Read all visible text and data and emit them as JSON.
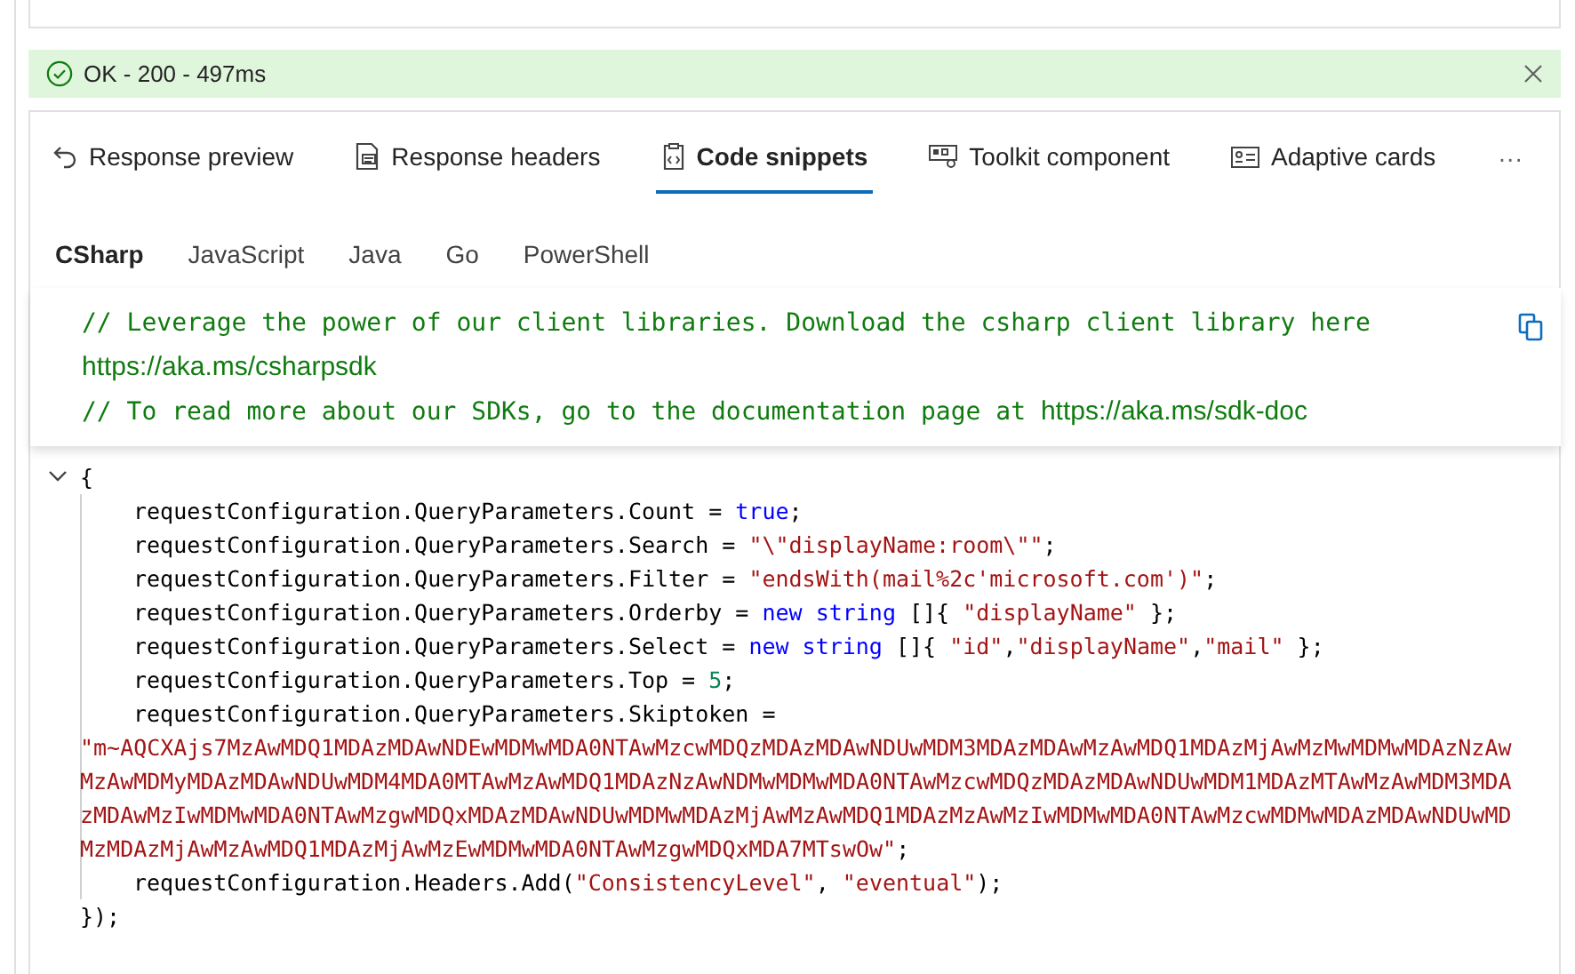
{
  "status": {
    "text": "OK - 200 - 497ms",
    "kind": "success"
  },
  "tabs": [
    {
      "label": "Response preview",
      "selected": false
    },
    {
      "label": "Response headers",
      "selected": false
    },
    {
      "label": "Code snippets",
      "selected": true
    },
    {
      "label": "Toolkit component",
      "selected": false
    },
    {
      "label": "Adaptive cards",
      "selected": false
    }
  ],
  "more_button": "···",
  "languages": [
    {
      "label": "CSharp",
      "selected": true
    },
    {
      "label": "JavaScript",
      "selected": false
    },
    {
      "label": "Java",
      "selected": false
    },
    {
      "label": "Go",
      "selected": false
    },
    {
      "label": "PowerShell",
      "selected": false
    }
  ],
  "notice": [
    [
      {
        "text": "// Leverage the power of our client libraries. Download the csharp client library here",
        "kind": "comment"
      }
    ],
    [
      {
        "text": "https://aka.ms/csharpsdk",
        "kind": "link"
      }
    ],
    [
      {
        "text": "// To read more about our SDKs, go to the documentation page at ",
        "kind": "comment"
      },
      {
        "text": "https://aka.ms/sdk-doc",
        "kind": "link"
      }
    ]
  ],
  "code": [
    {
      "indented": false,
      "fold": {
        "expanded": true
      },
      "tokens": [
        {
          "text": "{",
          "kind": "plain"
        }
      ]
    },
    {
      "indented": true,
      "tokens": [
        {
          "text": "requestConfiguration.QueryParameters.Count = ",
          "kind": "plain"
        },
        {
          "text": "true",
          "kind": "keyword"
        },
        {
          "text": ";",
          "kind": "plain"
        }
      ]
    },
    {
      "indented": true,
      "tokens": [
        {
          "text": "requestConfiguration.QueryParameters.Search = ",
          "kind": "plain"
        },
        {
          "text": "\"\\\"displayName:room\\\"\"",
          "kind": "string"
        },
        {
          "text": ";",
          "kind": "plain"
        }
      ]
    },
    {
      "indented": true,
      "tokens": [
        {
          "text": "requestConfiguration.QueryParameters.Filter = ",
          "kind": "plain"
        },
        {
          "text": "\"endsWith(mail%2c'microsoft.com')\"",
          "kind": "string"
        },
        {
          "text": ";",
          "kind": "plain"
        }
      ]
    },
    {
      "indented": true,
      "tokens": [
        {
          "text": "requestConfiguration.QueryParameters.Orderby = ",
          "kind": "plain"
        },
        {
          "text": "new string",
          "kind": "keyword"
        },
        {
          "text": " []{ ",
          "kind": "plain"
        },
        {
          "text": "\"displayName\"",
          "kind": "string"
        },
        {
          "text": " };",
          "kind": "plain"
        }
      ]
    },
    {
      "indented": true,
      "tokens": [
        {
          "text": "requestConfiguration.QueryParameters.Select = ",
          "kind": "plain"
        },
        {
          "text": "new string",
          "kind": "keyword"
        },
        {
          "text": " []{ ",
          "kind": "plain"
        },
        {
          "text": "\"id\"",
          "kind": "string"
        },
        {
          "text": ",",
          "kind": "plain"
        },
        {
          "text": "\"displayName\"",
          "kind": "string"
        },
        {
          "text": ",",
          "kind": "plain"
        },
        {
          "text": "\"mail\"",
          "kind": "string"
        },
        {
          "text": " };",
          "kind": "plain"
        }
      ]
    },
    {
      "indented": true,
      "tokens": [
        {
          "text": "requestConfiguration.QueryParameters.Top = ",
          "kind": "plain"
        },
        {
          "text": "5",
          "kind": "number"
        },
        {
          "text": ";",
          "kind": "plain"
        }
      ]
    },
    {
      "indented": true,
      "tokens": [
        {
          "text": "requestConfiguration.QueryParameters.Skiptoken =",
          "kind": "plain"
        }
      ]
    },
    {
      "indented": false,
      "tokens": [
        {
          "text": "\"m~AQCXAjs7MzAwMDQ1MDAzMDAwNDEwMDMwMDA0NTAwMzcwMDQzMDAzMDAwNDUwMDM3MDAzMDAwMzAwMDQ1MDAzMjAwMzMwMDMwMDAzNzAwMzAwMDMyMDAzMDAwNDUwMDM4MDA0MTAwMzAwMDQ1MDAzNzAwNDMwMDMwMDA0NTAwMzcwMDQzMDAzMDAwNDUwMDM1MDAzMTAwMzAwMDM3MDAzMDAwMzIwMDMwMDA0NTAwMzgwMDQxMDAzMDAwNDUwMDMwMDAzMjAwMzAwMDQ1MDAzMzAwMzIwMDMwMDA0NTAwMzcwMDMwMDAzMDAwNDUwMDMzMDAzMjAwMzAwMDQ1MDAzMjAwMzEwMDMwMDA0NTAwMzgwMDQxMDA7MTswOw\"",
          "kind": "string"
        },
        {
          "text": ";",
          "kind": "plain"
        }
      ]
    },
    {
      "indented": true,
      "tokens": [
        {
          "text": "requestConfiguration.Headers.Add(",
          "kind": "plain"
        },
        {
          "text": "\"ConsistencyLevel\"",
          "kind": "string"
        },
        {
          "text": ", ",
          "kind": "plain"
        },
        {
          "text": "\"eventual\"",
          "kind": "string"
        },
        {
          "text": ");",
          "kind": "plain"
        }
      ]
    },
    {
      "indented": false,
      "tokens": [
        {
          "text": "});",
          "kind": "plain"
        }
      ]
    }
  ]
}
